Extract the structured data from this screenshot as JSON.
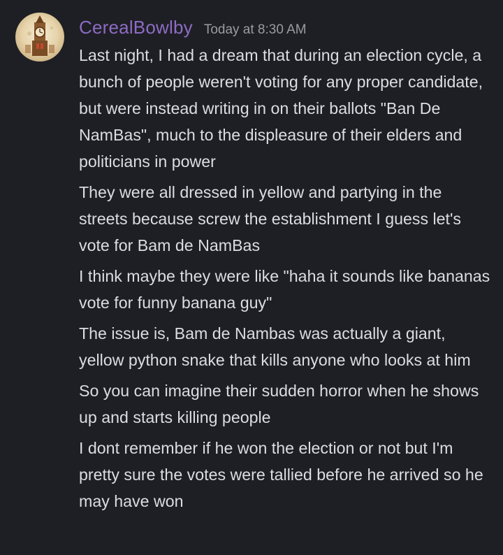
{
  "message": {
    "author": "CerealBowlby",
    "timestamp": "Today at 8:30 AM",
    "author_color": "#8d6bc4",
    "avatar_icon": "avatar-clock-tower-icon",
    "lines": [
      "Last night, I had a dream that during an election cycle, a bunch of people weren't voting for any proper candidate, but were instead writing in on their ballots \"Ban De NamBas\", much to the displeasure of their elders and politicians in power",
      "They were all dressed in yellow and partying in the streets because screw the establishment I guess let's vote for Bam de NamBas",
      "I think maybe they were like \"haha it sounds like bananas vote for funny banana guy\"",
      "The issue is, Bam de Nambas was actually a giant, yellow python snake that kills anyone who looks at him",
      "So you can imagine their sudden horror when he shows up and starts killing people",
      "I dont remember if he won the election or not but I'm pretty sure the votes were tallied before he arrived so he may have won"
    ]
  }
}
